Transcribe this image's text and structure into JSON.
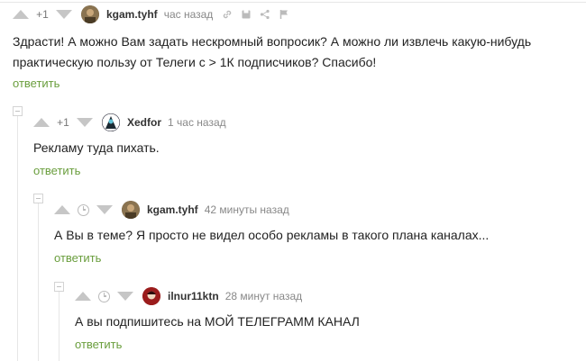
{
  "comments": [
    {
      "rating": "+1",
      "author": "kgam.tyhf",
      "time": "час назад",
      "text": "Здрасти! А можно Вам задать нескромный вопросик? А можно ли извлечь какую-нибудь практическую пользу от Телеги с > 1К подписчиков? Спасибо!",
      "reply": "ответить",
      "avatar_color": "#6b5a3e"
    },
    {
      "rating": "+1",
      "author": "Xedfor",
      "time": "1 час назад",
      "text": "Рекламу туда пихать.",
      "reply": "ответить",
      "avatar_color": "#1c2a33"
    },
    {
      "rating": "",
      "author": "kgam.tyhf",
      "time": "42 минуты назад",
      "text": "А Вы в теме? Я просто не видел особо рекламы в такого плана каналах...",
      "reply": "ответить",
      "avatar_color": "#6b5a3e"
    },
    {
      "rating": "",
      "author": "ilnur11ktn",
      "time": "28 минут назад",
      "text": "А вы подпишитесь на МОЙ ТЕЛЕГРАММ КАНАЛ",
      "reply": "ответить",
      "avatar_color": "#8b1a1a"
    }
  ]
}
